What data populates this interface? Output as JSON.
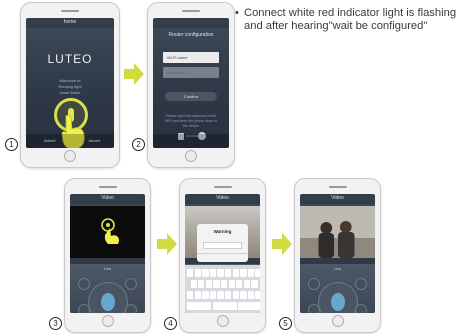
{
  "instruction": {
    "bullet": "•",
    "text": "Connect white red indicator light is flashing and after hearing\"wait be configured\""
  },
  "steps": [
    "1",
    "2",
    "3",
    "4",
    "5"
  ],
  "screen1": {
    "title": "home",
    "logo": "LUTEO",
    "welcome": [
      "Welcome to",
      "Reusing light",
      "smart bulbs"
    ],
    "bottom_left": "Advert",
    "bottom_right": "Advert"
  },
  "screen2": {
    "title": "Router configuration",
    "wifi_field": "Wi-Fi name",
    "password_field": "Password",
    "button": "Confirm",
    "note": "Please input the password of the WiFi and keep the phone close to the device"
  },
  "screen3": {
    "title": "Video",
    "mode": "Live"
  },
  "screen4": {
    "title": "Video",
    "dialog_title": "Warning"
  },
  "screen5": {
    "title": "Video",
    "mode": "Live"
  },
  "colors": {
    "accent": "#d9e04c",
    "arrow": "#cfdb3f",
    "screen": "#3a4553"
  }
}
